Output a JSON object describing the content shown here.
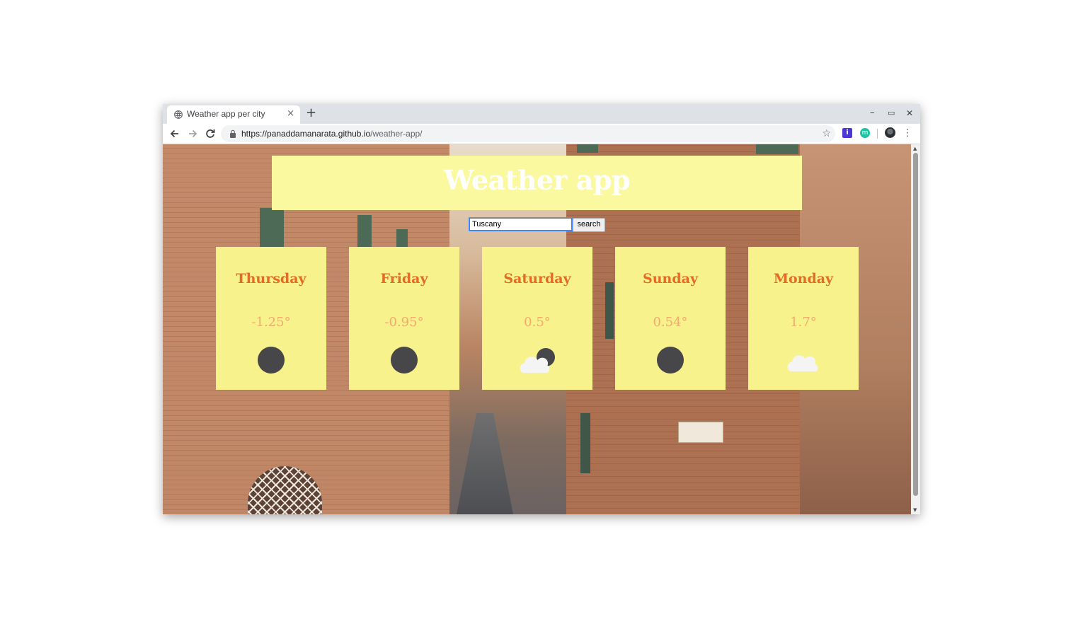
{
  "browser": {
    "tab_title": "Weather app per city",
    "tab_close": "×",
    "new_tab": "+",
    "url_host": "https://panaddamanarata.github.io",
    "url_path": "/weather-app/",
    "window_controls": {
      "minimize": "–",
      "restore": "▭",
      "close": "✕"
    },
    "star": "☆",
    "menu": "⋮",
    "ext1": "i",
    "ext2": "m"
  },
  "app": {
    "title": "Weather app",
    "search": {
      "value": "Tuscany",
      "button": "search"
    },
    "forecast": [
      {
        "day": "Thursday",
        "temp": "-1.25°",
        "icon": "clear-night-icon"
      },
      {
        "day": "Friday",
        "temp": "-0.95°",
        "icon": "clear-night-icon"
      },
      {
        "day": "Saturday",
        "temp": "0.5°",
        "icon": "partly-cloudy-night-icon"
      },
      {
        "day": "Sunday",
        "temp": "0.54°",
        "icon": "clear-night-icon"
      },
      {
        "day": "Monday",
        "temp": "1.7°",
        "icon": "cloudy-icon"
      }
    ]
  },
  "colors": {
    "header_bg": "#fbf99f",
    "card_bg": "#f7f28c",
    "day_text": "#e36b25",
    "temp_text": "#f2aa6e",
    "moon": "#474648",
    "cloud": "#f4f4f4"
  }
}
